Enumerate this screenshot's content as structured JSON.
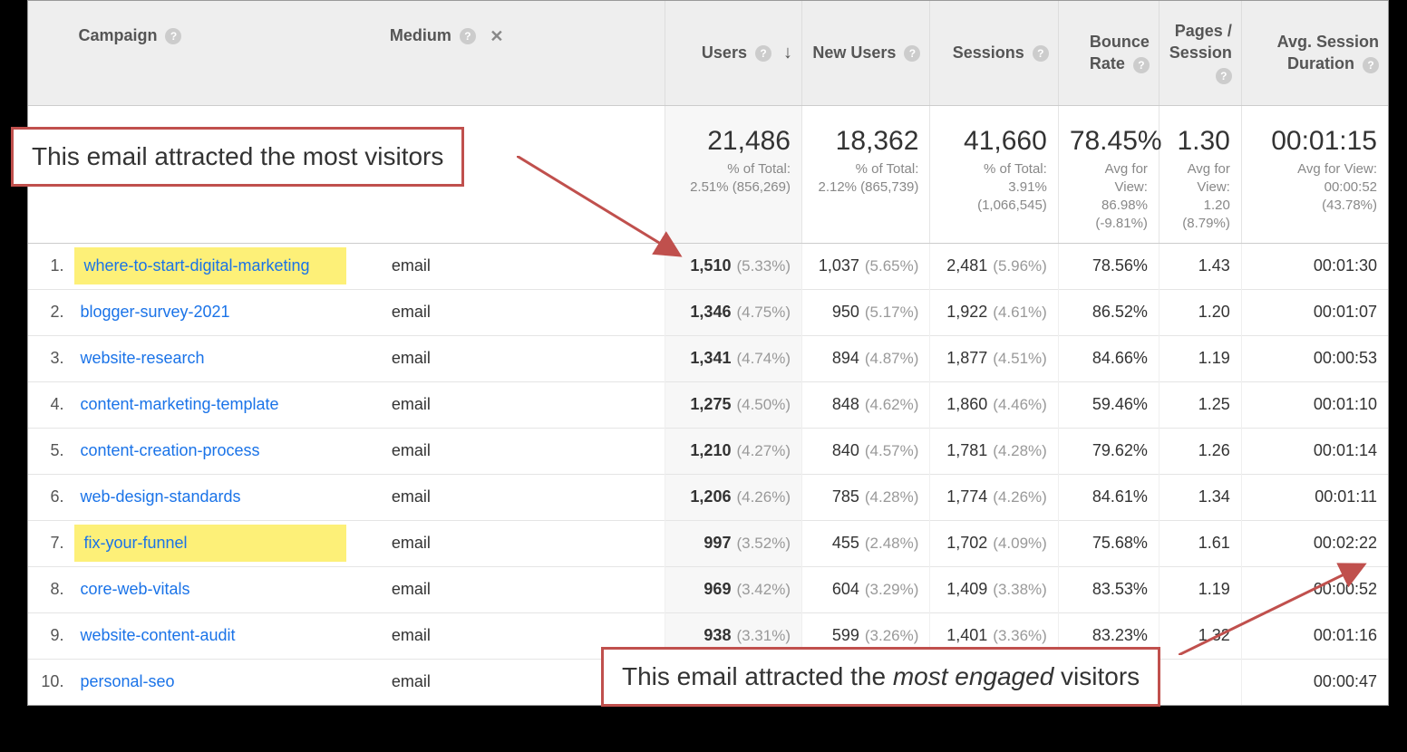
{
  "headers": {
    "campaign": "Campaign",
    "medium": "Medium",
    "users": "Users",
    "new_users": "New Users",
    "sessions": "Sessions",
    "bounce_rate": "Bounce Rate",
    "pages_session": "Pages / Session",
    "avg_duration": "Avg. Session Duration"
  },
  "summary": {
    "users": {
      "big": "21,486",
      "sub1": "% of Total:",
      "sub2": "2.51% (856,269)"
    },
    "new_users": {
      "big": "18,362",
      "sub1": "% of Total:",
      "sub2": "2.12% (865,739)"
    },
    "sessions": {
      "big": "41,660",
      "sub1": "% of Total:",
      "sub2": "3.91%",
      "sub3": "(1,066,545)"
    },
    "bounce_rate": {
      "big": "78.45%",
      "sub1": "Avg for View:",
      "sub2": "86.98%",
      "sub3": "(-9.81%)"
    },
    "pages_session": {
      "big": "1.30",
      "sub1": "Avg for View:",
      "sub2": "1.20",
      "sub3": "(8.79%)"
    },
    "avg_duration": {
      "big": "00:01:15",
      "sub1": "Avg for View:",
      "sub2": "00:00:52",
      "sub3": "(43.78%)"
    }
  },
  "rows": [
    {
      "n": "1.",
      "campaign": "where-to-start-digital-marketing",
      "medium": "email",
      "users": "1,510",
      "users_pct": "(5.33%)",
      "new_users": "1,037",
      "new_users_pct": "(5.65%)",
      "sessions": "2,481",
      "sessions_pct": "(5.96%)",
      "bounce": "78.56%",
      "pages": "1.43",
      "dur": "00:01:30",
      "highlight": true
    },
    {
      "n": "2.",
      "campaign": "blogger-survey-2021",
      "medium": "email",
      "users": "1,346",
      "users_pct": "(4.75%)",
      "new_users": "950",
      "new_users_pct": "(5.17%)",
      "sessions": "1,922",
      "sessions_pct": "(4.61%)",
      "bounce": "86.52%",
      "pages": "1.20",
      "dur": "00:01:07",
      "highlight": false
    },
    {
      "n": "3.",
      "campaign": "website-research",
      "medium": "email",
      "users": "1,341",
      "users_pct": "(4.74%)",
      "new_users": "894",
      "new_users_pct": "(4.87%)",
      "sessions": "1,877",
      "sessions_pct": "(4.51%)",
      "bounce": "84.66%",
      "pages": "1.19",
      "dur": "00:00:53",
      "highlight": false
    },
    {
      "n": "4.",
      "campaign": "content-marketing-template",
      "medium": "email",
      "users": "1,275",
      "users_pct": "(4.50%)",
      "new_users": "848",
      "new_users_pct": "(4.62%)",
      "sessions": "1,860",
      "sessions_pct": "(4.46%)",
      "bounce": "59.46%",
      "pages": "1.25",
      "dur": "00:01:10",
      "highlight": false
    },
    {
      "n": "5.",
      "campaign": "content-creation-process",
      "medium": "email",
      "users": "1,210",
      "users_pct": "(4.27%)",
      "new_users": "840",
      "new_users_pct": "(4.57%)",
      "sessions": "1,781",
      "sessions_pct": "(4.28%)",
      "bounce": "79.62%",
      "pages": "1.26",
      "dur": "00:01:14",
      "highlight": false
    },
    {
      "n": "6.",
      "campaign": "web-design-standards",
      "medium": "email",
      "users": "1,206",
      "users_pct": "(4.26%)",
      "new_users": "785",
      "new_users_pct": "(4.28%)",
      "sessions": "1,774",
      "sessions_pct": "(4.26%)",
      "bounce": "84.61%",
      "pages": "1.34",
      "dur": "00:01:11",
      "highlight": false
    },
    {
      "n": "7.",
      "campaign": "fix-your-funnel",
      "medium": "email",
      "users": "997",
      "users_pct": "(3.52%)",
      "new_users": "455",
      "new_users_pct": "(2.48%)",
      "sessions": "1,702",
      "sessions_pct": "(4.09%)",
      "bounce": "75.68%",
      "pages": "1.61",
      "dur": "00:02:22",
      "highlight": true
    },
    {
      "n": "8.",
      "campaign": "core-web-vitals",
      "medium": "email",
      "users": "969",
      "users_pct": "(3.42%)",
      "new_users": "604",
      "new_users_pct": "(3.29%)",
      "sessions": "1,409",
      "sessions_pct": "(3.38%)",
      "bounce": "83.53%",
      "pages": "1.19",
      "dur": "00:00:52",
      "highlight": false
    },
    {
      "n": "9.",
      "campaign": "website-content-audit",
      "medium": "email",
      "users": "938",
      "users_pct": "(3.31%)",
      "new_users": "599",
      "new_users_pct": "(3.26%)",
      "sessions": "1,401",
      "sessions_pct": "(3.36%)",
      "bounce": "83.23%",
      "pages": "1.32",
      "dur": "00:01:16",
      "highlight": false
    },
    {
      "n": "10.",
      "campaign": "personal-seo",
      "medium": "email",
      "users": "",
      "users_pct": "",
      "new_users": "",
      "new_users_pct": "",
      "sessions": "",
      "sessions_pct": "",
      "bounce": "",
      "pages": "",
      "dur": "00:00:47",
      "highlight": false
    }
  ],
  "callouts": {
    "top": "This email attracted the most visitors",
    "bottom_pre": "This email attracted the ",
    "bottom_em": "most engaged",
    "bottom_post": " visitors"
  }
}
